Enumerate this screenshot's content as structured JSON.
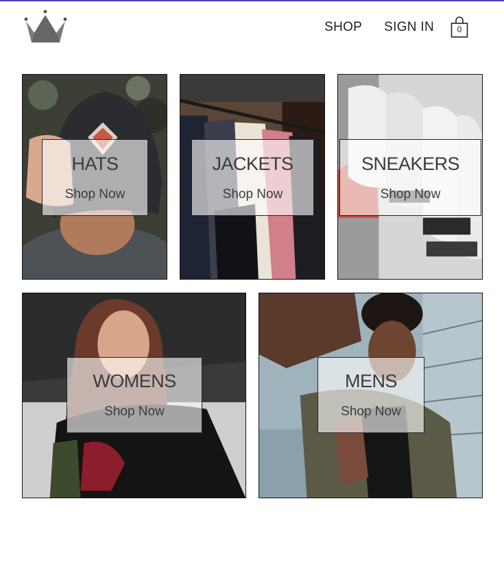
{
  "header": {
    "logo_icon": "crown-icon",
    "nav": {
      "shop": "SHOP",
      "sign_in": "SIGN IN"
    },
    "cart": {
      "icon": "shopping-bag-icon",
      "count": "0"
    }
  },
  "menu": {
    "items": [
      {
        "title": "HATS",
        "subtitle": "Shop Now"
      },
      {
        "title": "JACKETS",
        "subtitle": "Shop Now"
      },
      {
        "title": "SNEAKERS",
        "subtitle": "Shop Now"
      },
      {
        "title": "WOMENS",
        "subtitle": "Shop Now"
      },
      {
        "title": "MENS",
        "subtitle": "Shop Now"
      }
    ]
  },
  "colors": {
    "top_border": "#4a3fc1",
    "text": "#3b3b3b"
  }
}
